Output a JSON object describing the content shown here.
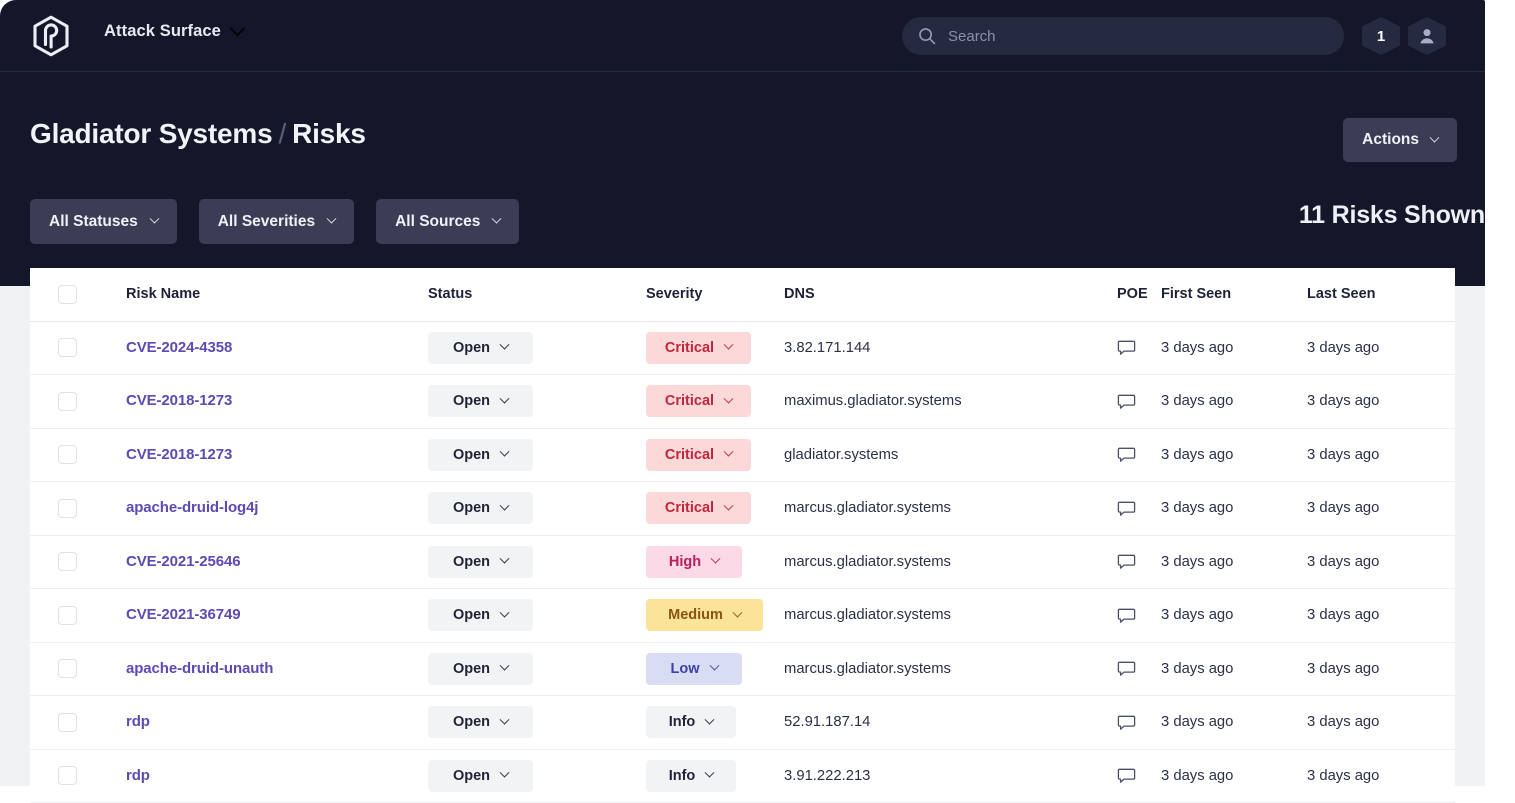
{
  "window": {
    "dark_bg": "#141729",
    "page_bg": "#f1f2f4"
  },
  "topnav": {
    "logo_icon": "hexagon-shield-logo-icon",
    "brand_label": "Attack Surface",
    "brand_chevron_icon": "chevron-down-icon",
    "search": {
      "icon": "search-icon",
      "placeholder": "Search",
      "value": ""
    },
    "notification_count": "1",
    "avatar_icon": "user-avatar-icon"
  },
  "header": {
    "breadcrumb_parent": "Gladiator Systems",
    "breadcrumb_separator": "/",
    "breadcrumb_current": "Risks",
    "actions_label": "Actions",
    "actions_chevron_icon": "chevron-down-icon"
  },
  "filters": {
    "buttons": [
      {
        "label": "All Statuses",
        "icon": "chevron-down-icon"
      },
      {
        "label": "All Severities",
        "icon": "chevron-down-icon"
      },
      {
        "label": "All Sources",
        "icon": "chevron-down-icon"
      }
    ],
    "count_label": "11 Risks Shown"
  },
  "table": {
    "columns": [
      {
        "key": "check",
        "label": ""
      },
      {
        "key": "name",
        "label": "Risk Name"
      },
      {
        "key": "status",
        "label": "Status"
      },
      {
        "key": "severity",
        "label": "Severity"
      },
      {
        "key": "dns",
        "label": "DNS"
      },
      {
        "key": "poe",
        "label": "POE"
      },
      {
        "key": "first",
        "label": "First Seen"
      },
      {
        "key": "last",
        "label": "Last Seen"
      }
    ],
    "select_all_checkbox": false,
    "poe_icon": "comment-bubble-icon",
    "rows": [
      {
        "name": "CVE-2024-4358",
        "status": "Open",
        "severity": "Critical",
        "severity_class": "sev-critical",
        "dns": "3.82.171.144",
        "first_seen": "3 days ago",
        "last_seen": "3 days ago"
      },
      {
        "name": "CVE-2018-1273",
        "status": "Open",
        "severity": "Critical",
        "severity_class": "sev-critical",
        "dns": "maximus.gladiator.systems",
        "first_seen": "3 days ago",
        "last_seen": "3 days ago"
      },
      {
        "name": "CVE-2018-1273",
        "status": "Open",
        "severity": "Critical",
        "severity_class": "sev-critical",
        "dns": "gladiator.systems",
        "first_seen": "3 days ago",
        "last_seen": "3 days ago"
      },
      {
        "name": "apache-druid-log4j",
        "status": "Open",
        "severity": "Critical",
        "severity_class": "sev-critical",
        "dns": "marcus.gladiator.systems",
        "first_seen": "3 days ago",
        "last_seen": "3 days ago"
      },
      {
        "name": "CVE-2021-25646",
        "status": "Open",
        "severity": "High",
        "severity_class": "sev-high",
        "dns": "marcus.gladiator.systems",
        "first_seen": "3 days ago",
        "last_seen": "3 days ago"
      },
      {
        "name": "CVE-2021-36749",
        "status": "Open",
        "severity": "Medium",
        "severity_class": "sev-medium",
        "dns": "marcus.gladiator.systems",
        "first_seen": "3 days ago",
        "last_seen": "3 days ago"
      },
      {
        "name": "apache-druid-unauth",
        "status": "Open",
        "severity": "Low",
        "severity_class": "sev-low",
        "dns": "marcus.gladiator.systems",
        "first_seen": "3 days ago",
        "last_seen": "3 days ago"
      },
      {
        "name": "rdp",
        "status": "Open",
        "severity": "Info",
        "severity_class": "sev-info",
        "dns": "52.91.187.14",
        "first_seen": "3 days ago",
        "last_seen": "3 days ago"
      },
      {
        "name": "rdp",
        "status": "Open",
        "severity": "Info",
        "severity_class": "sev-info",
        "dns": "3.91.222.213",
        "first_seen": "3 days ago",
        "last_seen": "3 days ago"
      }
    ]
  },
  "colors": {
    "link_purple": "#5e49b5",
    "critical_bg": "#fbd9d9",
    "critical_fg": "#c0273c",
    "high_bg": "#fbd9e6",
    "high_fg": "#bb1f5e",
    "medium_bg": "#fbe39a",
    "medium_fg": "#8a5514",
    "low_bg": "#d8ddf3",
    "low_fg": "#3c41a8",
    "neutral_bg": "#f2f3f5",
    "neutral_fg": "#1f2337"
  }
}
